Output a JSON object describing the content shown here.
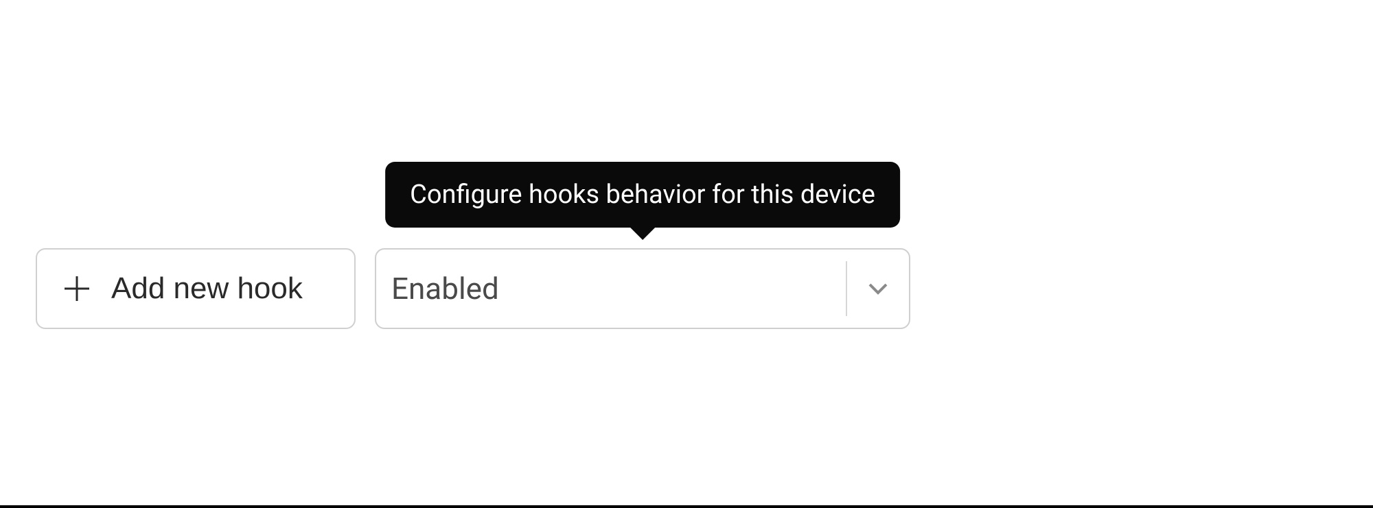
{
  "controls": {
    "add_hook_label": "Add new hook",
    "dropdown": {
      "selected": "Enabled",
      "tooltip": "Configure hooks behavior for this device"
    }
  }
}
